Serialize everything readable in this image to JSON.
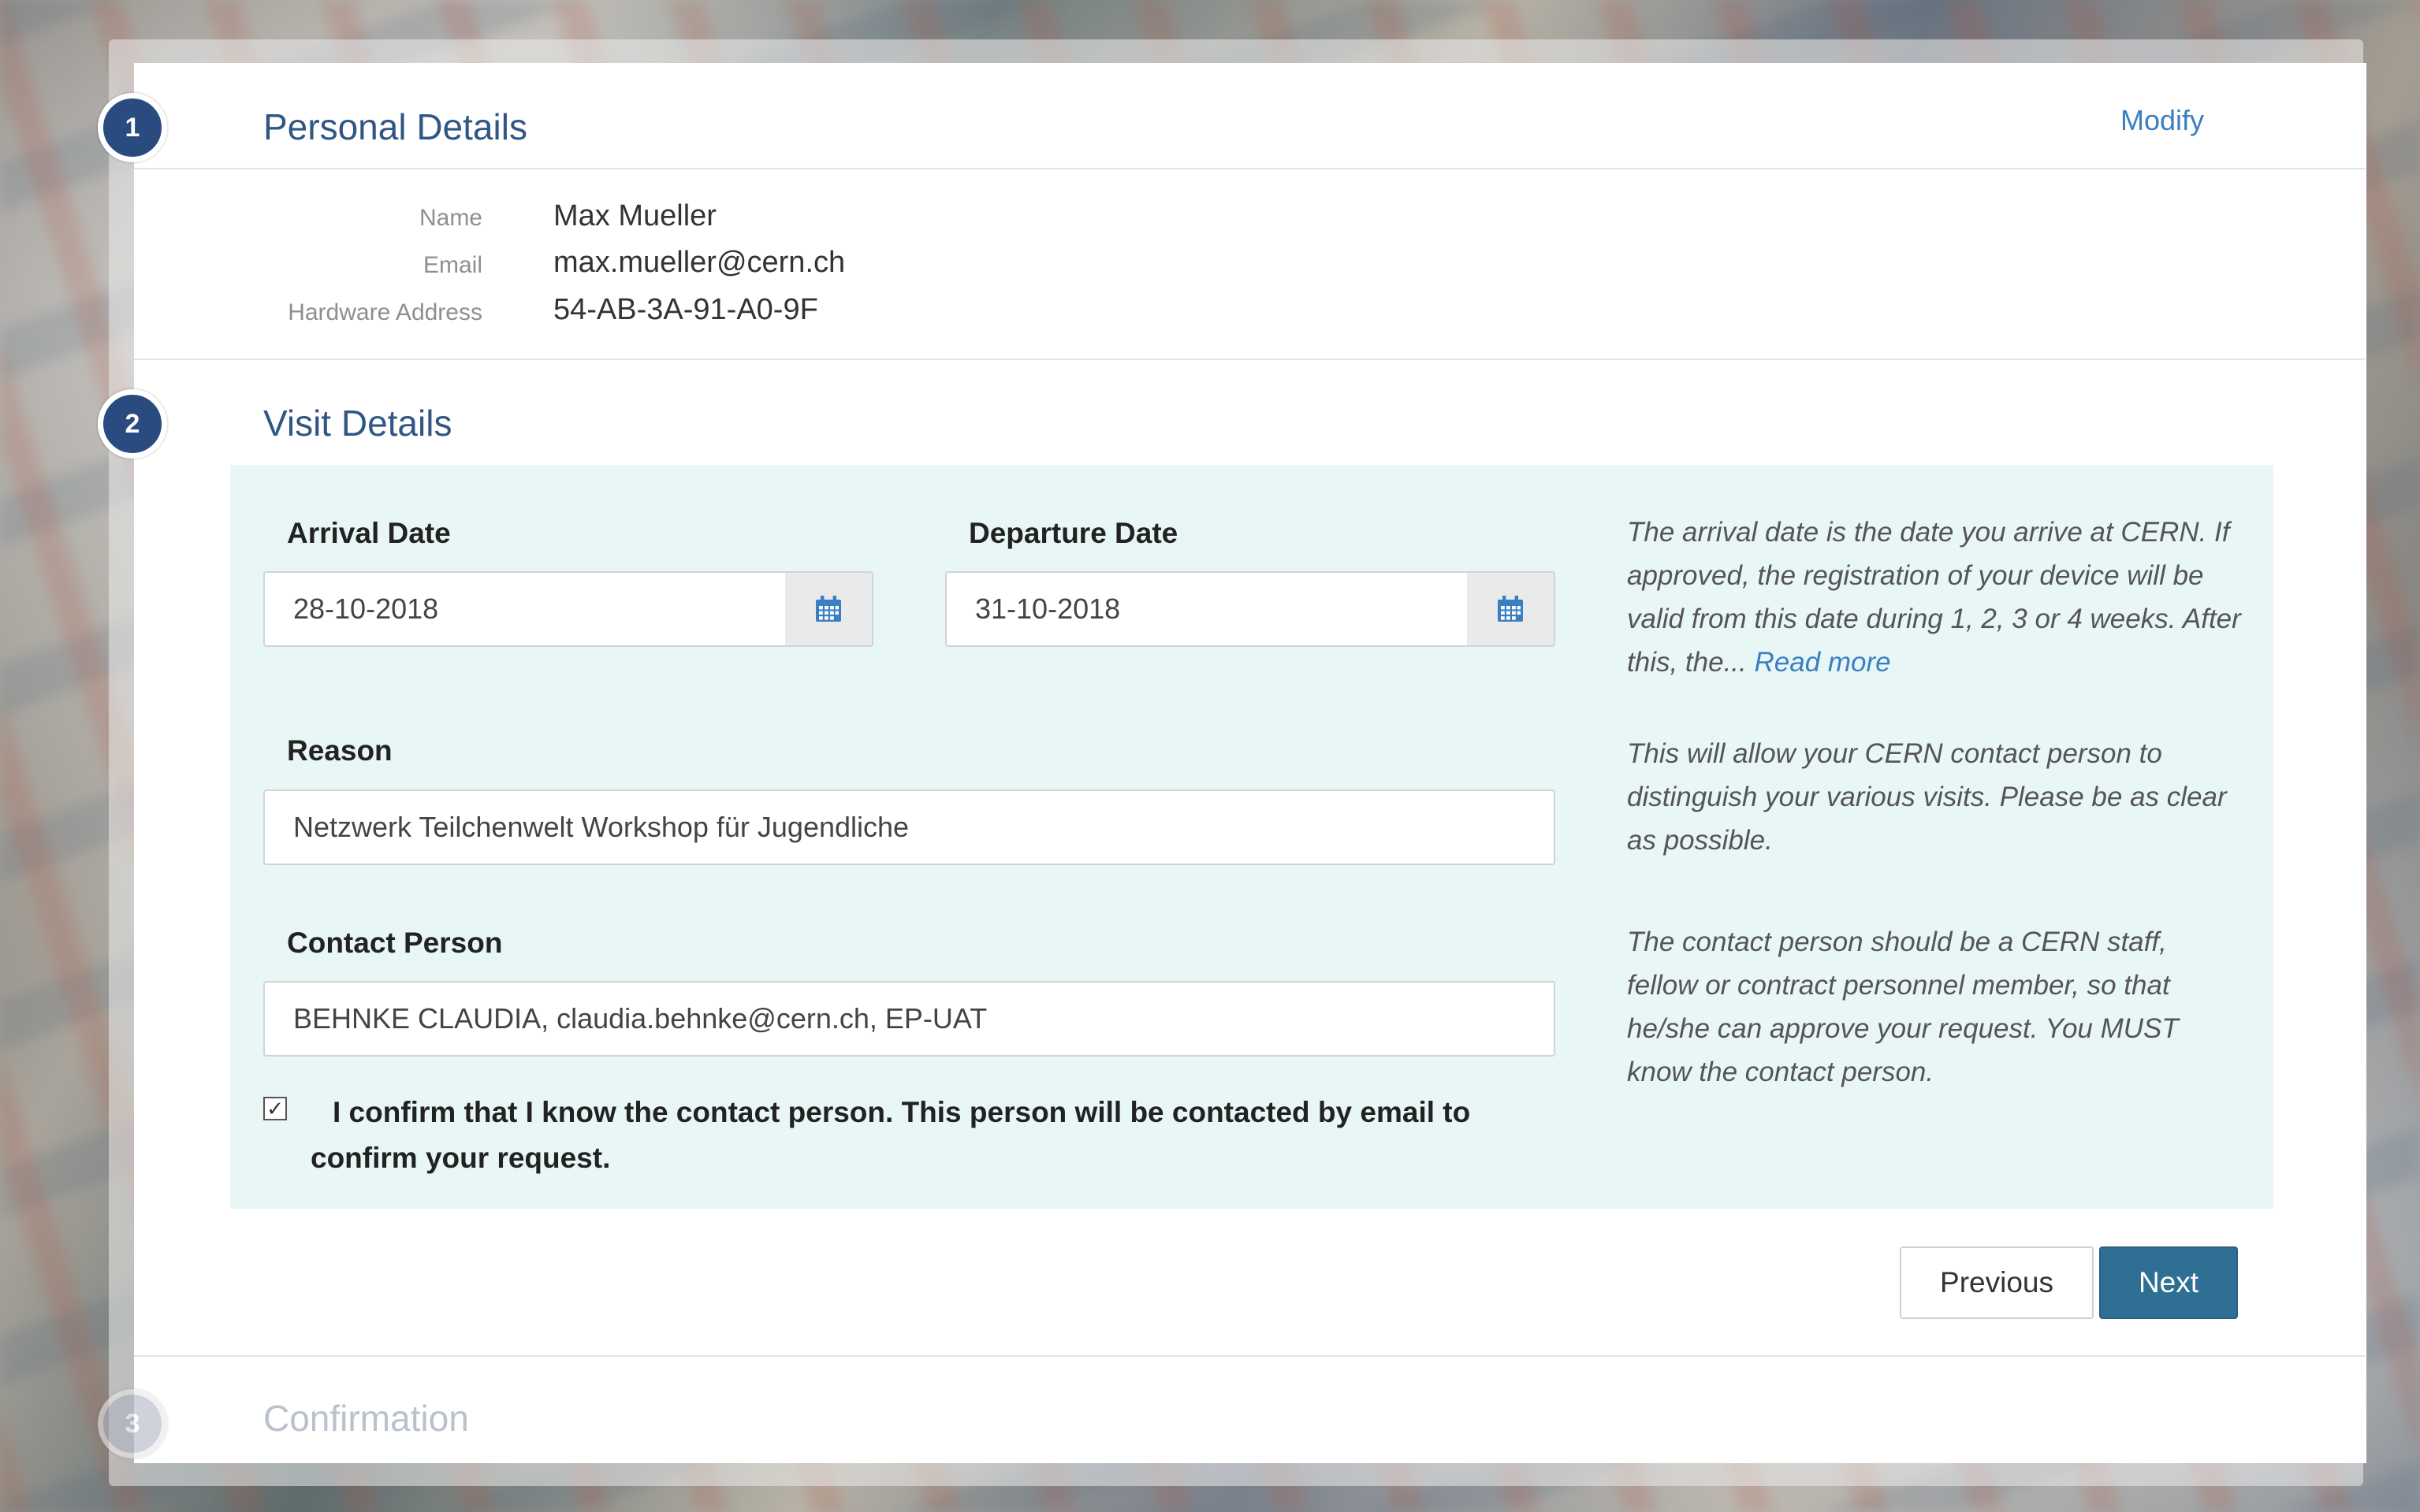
{
  "steps": [
    {
      "number": "1",
      "title": "Personal Details",
      "action": "Modify"
    },
    {
      "number": "2",
      "title": "Visit Details"
    },
    {
      "number": "3",
      "title": "Confirmation"
    }
  ],
  "personal": {
    "rows": [
      {
        "label": "Name",
        "value": "Max Mueller"
      },
      {
        "label": "Email",
        "value": "max.mueller@cern.ch"
      },
      {
        "label": "Hardware Address",
        "value": "54-AB-3A-91-A0-9F"
      }
    ]
  },
  "visit": {
    "arrival_label": "Arrival Date",
    "arrival_value": "28-10-2018",
    "departure_label": "Departure Date",
    "departure_value": "31-10-2018",
    "reason_label": "Reason",
    "reason_value": "Netzwerk Teilchenwelt Workshop für Jugendliche",
    "contact_label": "Contact Person",
    "contact_value": "BEHNKE CLAUDIA, claudia.behnke@cern.ch, EP-UAT",
    "confirm_checked": true,
    "confirm_text": "I confirm that I know the contact person. This person will be contacted by email to confirm your request.",
    "help_dates": "The arrival date is the date you arrive at CERN. If approved, the registration of your device will be valid from this date during 1, 2, 3 or 4 weeks. After this, the...",
    "help_dates_link": "Read more",
    "help_reason": "This will allow your CERN contact person to distinguish your various visits. Please be as clear as possible.",
    "help_contact": "The contact person should be a CERN staff, fellow or contract personnel member, so that he/she can approve your request. You MUST know the contact person."
  },
  "buttons": {
    "previous": "Previous",
    "next": "Next"
  },
  "icons": {
    "calendar": "calendar-icon",
    "checkbox": "checkmark-icon"
  },
  "colors": {
    "accent": "#2a4b80",
    "link": "#3a7fc2",
    "panel": "#e8f7f6",
    "next_button": "#2e6f93"
  }
}
